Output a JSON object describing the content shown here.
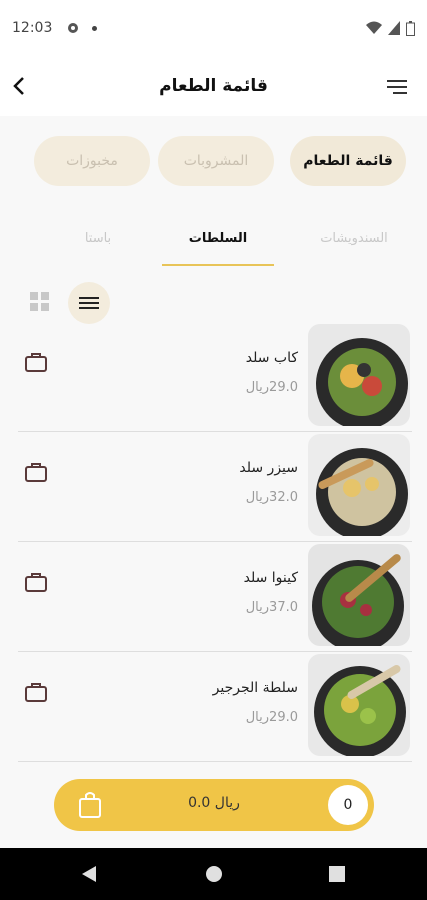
{
  "status": {
    "time": "12:03"
  },
  "header": {
    "title": "قائمة الطعام"
  },
  "categories": [
    {
      "label": "قائمة الطعام",
      "active": true
    },
    {
      "label": "المشروبات",
      "active": false
    },
    {
      "label": "مخبوزات",
      "active": false
    }
  ],
  "tabs": [
    {
      "label": "السندويشات",
      "active": false
    },
    {
      "label": "السلطات",
      "active": true
    },
    {
      "label": "باستا",
      "active": false
    }
  ],
  "items": [
    {
      "name": "كاب سلد",
      "price": "29.0ريال"
    },
    {
      "name": "سيزر سلد",
      "price": "32.0ريال"
    },
    {
      "name": "كينوا سلد",
      "price": "37.0ريال"
    },
    {
      "name": "سلطة الجرجير",
      "price": "29.0ريال"
    }
  ],
  "cart": {
    "count": "0",
    "total": "0.0 ريال"
  },
  "colors": {
    "accent": "#f0c547",
    "pill": "#f3ecdd",
    "underline": "#e8c458"
  }
}
